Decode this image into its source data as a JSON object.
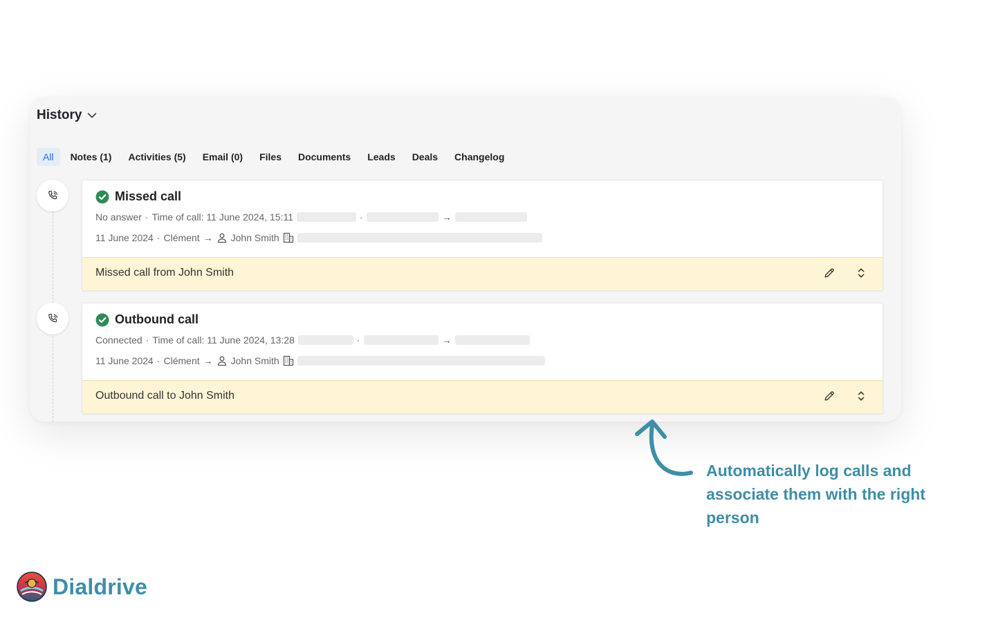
{
  "history": {
    "title": "History",
    "tabs": [
      {
        "label": "All",
        "active": true
      },
      {
        "label": "Notes (1)"
      },
      {
        "label": "Activities (5)"
      },
      {
        "label": "Email (0)"
      },
      {
        "label": "Files"
      },
      {
        "label": "Documents"
      },
      {
        "label": "Leads"
      },
      {
        "label": "Deals"
      },
      {
        "label": "Changelog"
      }
    ]
  },
  "calls": [
    {
      "title": "Missed call",
      "status": "No answer",
      "time_of_call": "Time of call: 11 June 2024, 15:11",
      "date": "11 June 2024",
      "user": "Clément",
      "contact": "John Smith",
      "note": "Missed call from John Smith"
    },
    {
      "title": "Outbound call",
      "status": "Connected",
      "time_of_call": "Time of call: 11 June 2024, 13:28",
      "date": "11 June 2024",
      "user": "Clément",
      "contact": "John Smith",
      "note": "Outbound call to John Smith"
    }
  ],
  "separators": {
    "dot": "·",
    "arrow": "→"
  },
  "annotation": {
    "text": "Automatically log calls and associate them with the right person"
  },
  "brand": {
    "name": "Dialdrive"
  },
  "colors": {
    "accent": "#3e8ea6",
    "success": "#2e8b57",
    "note_bg": "#fdf5d6",
    "active_tab": "#2a6ad6"
  }
}
